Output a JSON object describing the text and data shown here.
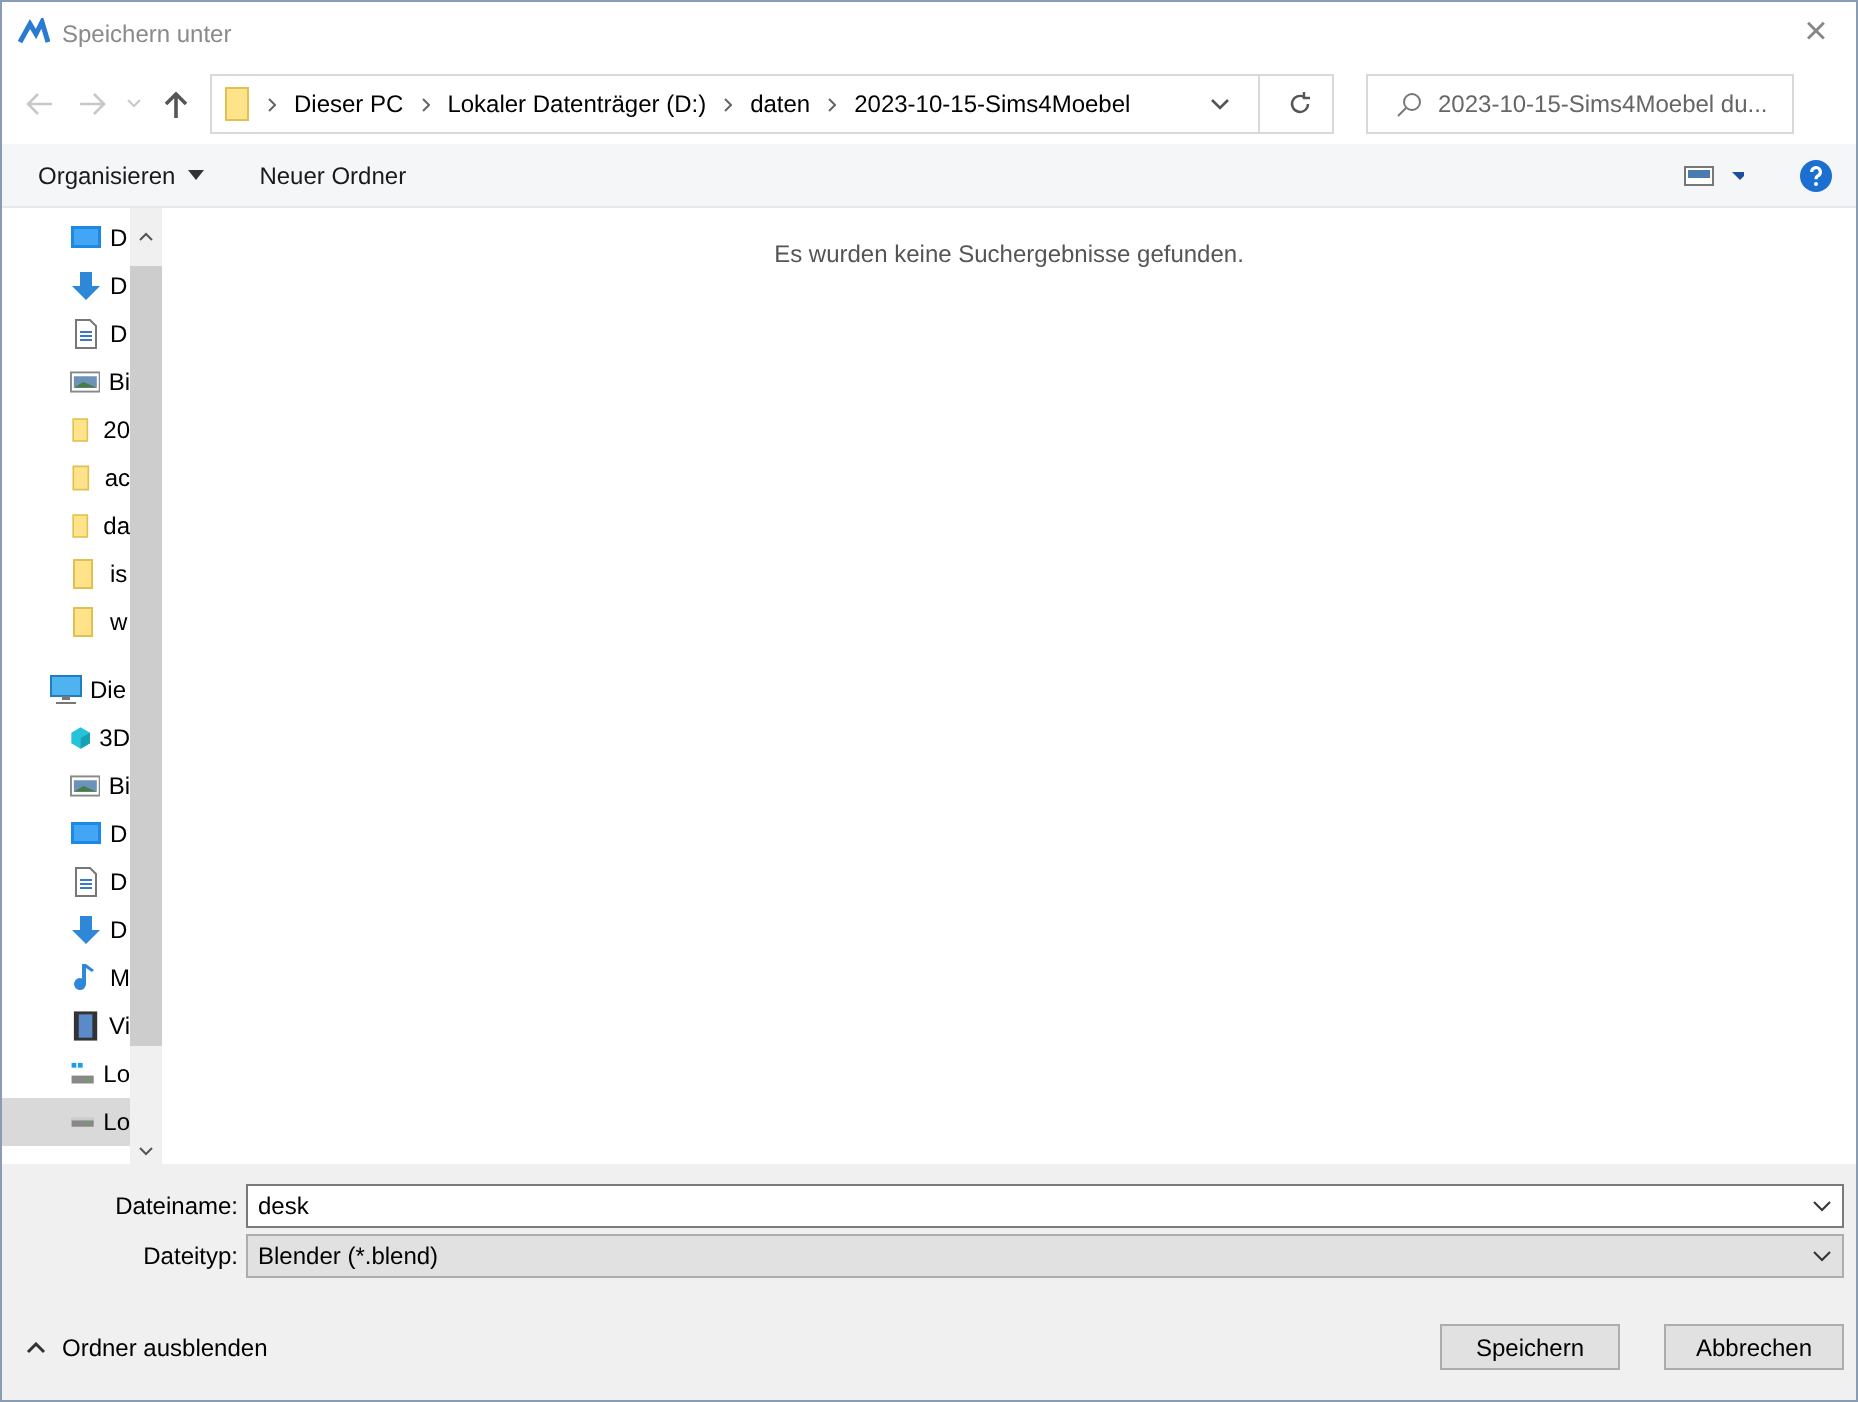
{
  "window": {
    "title": "Speichern unter",
    "close": "×"
  },
  "address_bar": {
    "crumbs": [
      "Dieser PC",
      "Lokaler Datenträger (D:)",
      "daten",
      "2023-10-15-Sims4Moebel"
    ]
  },
  "search": {
    "placeholder": "2023-10-15-Sims4Moebel du..."
  },
  "toolbar": {
    "organize": "Organisieren",
    "new_folder": "Neuer Ordner"
  },
  "sidebar": {
    "items": [
      {
        "label": "D",
        "kind": "desktop",
        "selected": false
      },
      {
        "label": "D",
        "kind": "download",
        "selected": false
      },
      {
        "label": "D",
        "kind": "document",
        "selected": false
      },
      {
        "label": "Bi",
        "kind": "image",
        "selected": false
      },
      {
        "label": "20",
        "kind": "folder",
        "selected": false
      },
      {
        "label": "ac",
        "kind": "folder",
        "selected": false
      },
      {
        "label": "da",
        "kind": "folder",
        "selected": false
      },
      {
        "label": "is",
        "kind": "folder",
        "selected": false
      },
      {
        "label": "w",
        "kind": "folder",
        "selected": false
      },
      {
        "label": "Die",
        "kind": "pc",
        "selected": false,
        "children": [
          {
            "label": "3D",
            "kind": "cube",
            "selected": false
          },
          {
            "label": "Bi",
            "kind": "image",
            "selected": false
          },
          {
            "label": "D",
            "kind": "desktop",
            "selected": false
          },
          {
            "label": "D",
            "kind": "document",
            "selected": false
          },
          {
            "label": "D",
            "kind": "download",
            "selected": false
          },
          {
            "label": "M",
            "kind": "music",
            "selected": false
          },
          {
            "label": "Vi",
            "kind": "video",
            "selected": false
          },
          {
            "label": "Lo",
            "kind": "windrive",
            "selected": false
          },
          {
            "label": "Lo",
            "kind": "drive",
            "selected": true
          }
        ]
      }
    ]
  },
  "content": {
    "message": "Es wurden keine Suchergebnisse gefunden."
  },
  "form": {
    "filename_label": "Dateiname:",
    "filename": "desk",
    "filetype_label": "Dateityp:",
    "filetype": "Blender (*.blend)"
  },
  "footer": {
    "toggle": "Ordner ausblenden",
    "buttons": [
      "Speichern",
      "Abbrechen"
    ]
  }
}
